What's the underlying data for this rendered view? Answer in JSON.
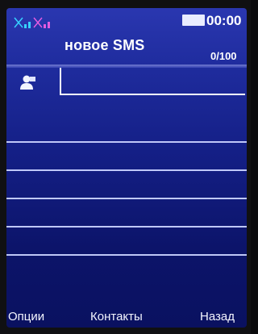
{
  "status": {
    "signal_icon": "signal-bars-icon",
    "battery_icon": "battery-icon",
    "time": "00:00"
  },
  "header": {
    "title": "новое SMS",
    "char_counter": "0/100"
  },
  "recipient": {
    "icon": "contact-person-icon",
    "value": "",
    "placeholder": ""
  },
  "softkeys": {
    "left": "Опции",
    "center": "Контакты",
    "right": "Назад"
  },
  "colors": {
    "background_top": "#2a37b0",
    "background_bottom": "#0a1160",
    "text": "#ffffff",
    "rule_lines": "#c9d2ff"
  }
}
